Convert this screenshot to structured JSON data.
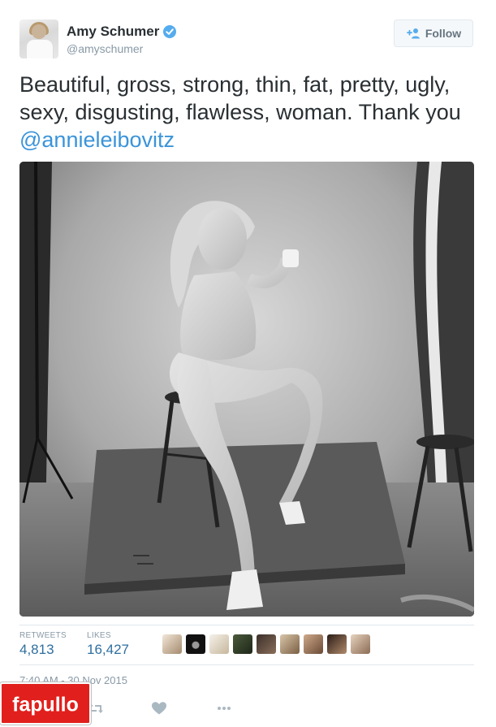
{
  "tweet": {
    "author_name": "Amy Schumer",
    "author_handle": "@amyschumer",
    "verified_icon": "verified-badge-icon",
    "follow_label": "Follow",
    "text_plain": "Beautiful, gross, strong, thin, fat, pretty, ugly, sexy, disgusting, flawless, woman. Thank you ",
    "text_mention": "@annieleibovitz",
    "image_alt": "Black and white studio portrait of a woman seated on a wooden stool"
  },
  "stats": {
    "retweets_label": "RETWEETS",
    "retweets_count": "4,813",
    "likes_label": "LIKES",
    "likes_count": "16,427"
  },
  "likers_count_shown": 9,
  "timestamp": "7:40 AM - 30 Nov 2015",
  "actions": [
    "reply-icon",
    "retweet-icon",
    "like-icon",
    "more-icon"
  ],
  "watermark": "fapullo",
  "colors": {
    "link": "#3b94d9",
    "stat_value": "#2f6f9f",
    "muted": "#8899a6",
    "watermark_bg": "#e1201d"
  }
}
